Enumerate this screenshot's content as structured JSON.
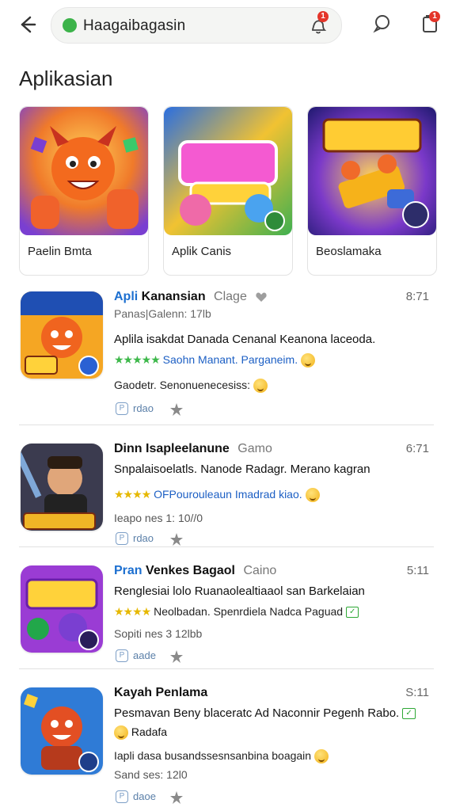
{
  "topbar": {
    "search_value": "Haagaibagasin",
    "search_icon_badge": "1",
    "cart_badge": "1"
  },
  "page": {
    "title": "Aplikasian"
  },
  "cards": [
    {
      "label": "Paelin Bmta"
    },
    {
      "label": "Aplik Canis"
    },
    {
      "label": "Beoslamaka"
    }
  ],
  "apps": [
    {
      "prefix": "Apli",
      "name": "Kanansian",
      "tag": "Clage",
      "time": "8:71",
      "sub": "Panas|Galenn: 17lb",
      "desc": "Aplila isakdat Danada Cenanal  Keanona laceoda.",
      "rating_text": "Saohn Manant. Parganeim.",
      "line3": "Gaodetr. Senonuenecesiss:",
      "btn": "rdao"
    },
    {
      "prefix": "",
      "name": "Dinn Isapleelanune",
      "tag": "Gamo",
      "time": "6:71",
      "sub": "",
      "desc": "Snpalaisoelatls. Nanode Radagr. Merano kagran",
      "rating_text": "OFPourouleaun Imadrad kiao.",
      "line3": "Ieapo nes 1: 10//0",
      "btn": "rdao"
    },
    {
      "prefix": "Pran",
      "name": "Venkes Bagaol",
      "tag": "Caino",
      "time": "5:11",
      "sub": "",
      "desc": "Renglesiai lolo Ruanaolealtiaaol san Barkelaian",
      "rating_text": "Neolbadan. Spenrdiela Nadca Paguad",
      "line3": "Sopiti nes 3 12lbb",
      "btn": "aade"
    },
    {
      "prefix": "",
      "name": "Kayah Penlama",
      "tag": "",
      "time": "S:11",
      "sub": "",
      "desc": "Pesmavan Beny blaceratc Ad Naconnir Pegenh Rabo.",
      "rating_text": "Radafa",
      "line3": "Iapli dasa busandssesnsanbina boagain",
      "line4": "Sand ses: 12l0",
      "btn": "daoe"
    }
  ],
  "colors": {
    "accent_blue": "#1c6fd0",
    "star_yellow": "#e6b800",
    "badge_red": "#e4352a",
    "secure_green": "#3cb34a"
  }
}
